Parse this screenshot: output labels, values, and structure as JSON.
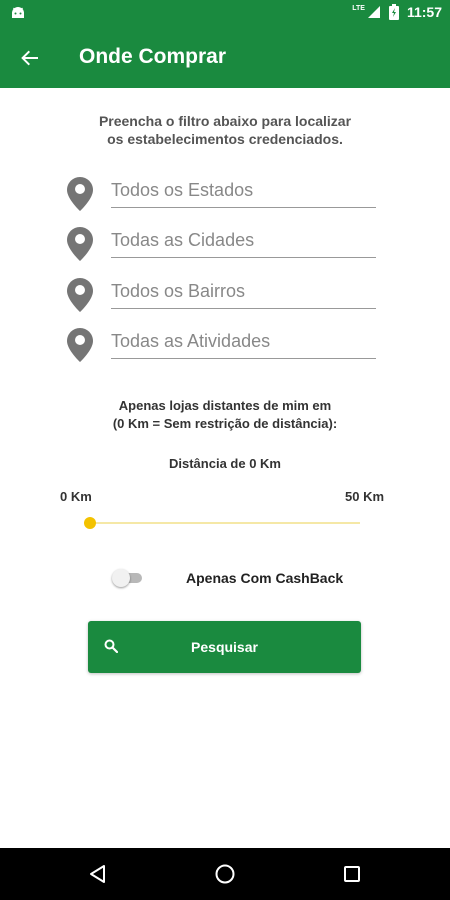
{
  "status_bar": {
    "time": "11:57",
    "network_label": "LTE"
  },
  "app_bar": {
    "title": "Onde Comprar"
  },
  "intro": {
    "line1": "Preencha o filtro abaixo para localizar",
    "line2": "os estabelecimentos credenciados."
  },
  "filters": [
    {
      "placeholder": "Todos os Estados",
      "icon": "location-pin-icon"
    },
    {
      "placeholder": "Todas as Cidades",
      "icon": "location-pin-icon"
    },
    {
      "placeholder": "Todos os Bairros",
      "icon": "location-pin-icon"
    },
    {
      "placeholder": "Todas as Atividades",
      "icon": "location-pin-icon"
    }
  ],
  "distance": {
    "note_line1": "Apenas lojas distantes de mim em",
    "note_line2": "(0 Km = Sem restrição de distância):",
    "current_label": "Distância de 0 Km",
    "min_label": "0 Km",
    "max_label": "50 Km",
    "value_km": 0,
    "max_km": 50
  },
  "cashback": {
    "label": "Apenas Com CashBack",
    "enabled": false
  },
  "search_button": {
    "label": "Pesquisar",
    "icon": "search-icon"
  },
  "colors": {
    "primary": "#1a8a3f",
    "accent": "#f3c200",
    "nav_bar": "#000000"
  }
}
